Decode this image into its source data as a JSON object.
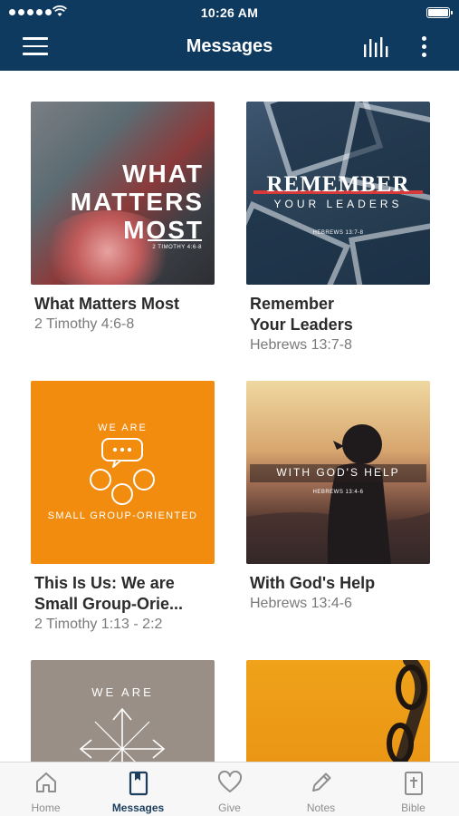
{
  "status_bar": {
    "time": "10:26 AM"
  },
  "nav": {
    "title": "Messages"
  },
  "messages": [
    {
      "title": "What Matters Most",
      "reference": "2 Timothy 4:6-8",
      "art": {
        "lines": [
          "WHAT",
          "MATTERS",
          "MOST"
        ],
        "ref": "2 TIMOTHY 4:6-8"
      }
    },
    {
      "title_line1": "Remember",
      "title_line2": "Your Leaders",
      "reference": "Hebrews 13:7-8",
      "art": {
        "big": "REMEMBER",
        "small": "YOUR LEADERS",
        "ref": "HEBREWS 13:7-8"
      }
    },
    {
      "title_line1": "This Is Us: We are",
      "title_line2": "Small Group-Orie...",
      "reference": "2 Timothy 1:13 - 2:2",
      "art": {
        "top": "WE ARE",
        "bottom": "SMALL GROUP-ORIENTED"
      }
    },
    {
      "title": "With God's Help",
      "reference": "Hebrews 13:4-6",
      "art": {
        "headline": "WITH GOD'S HELP",
        "ref": "HEBREWS 13:4-6"
      }
    },
    {
      "art": {
        "top": "WE ARE"
      }
    },
    {
      "art": {}
    }
  ],
  "tabs": [
    {
      "label": "Home",
      "icon": "home-icon"
    },
    {
      "label": "Messages",
      "icon": "book-icon",
      "active": true
    },
    {
      "label": "Give",
      "icon": "heart-icon"
    },
    {
      "label": "Notes",
      "icon": "pencil-icon"
    },
    {
      "label": "Bible",
      "icon": "bible-icon"
    }
  ],
  "colors": {
    "nav_background": "#0f3a5f",
    "active_tab": "#1b3e5f",
    "inactive_tab": "#8e8e8e",
    "orange_art": "#f28c0f"
  }
}
